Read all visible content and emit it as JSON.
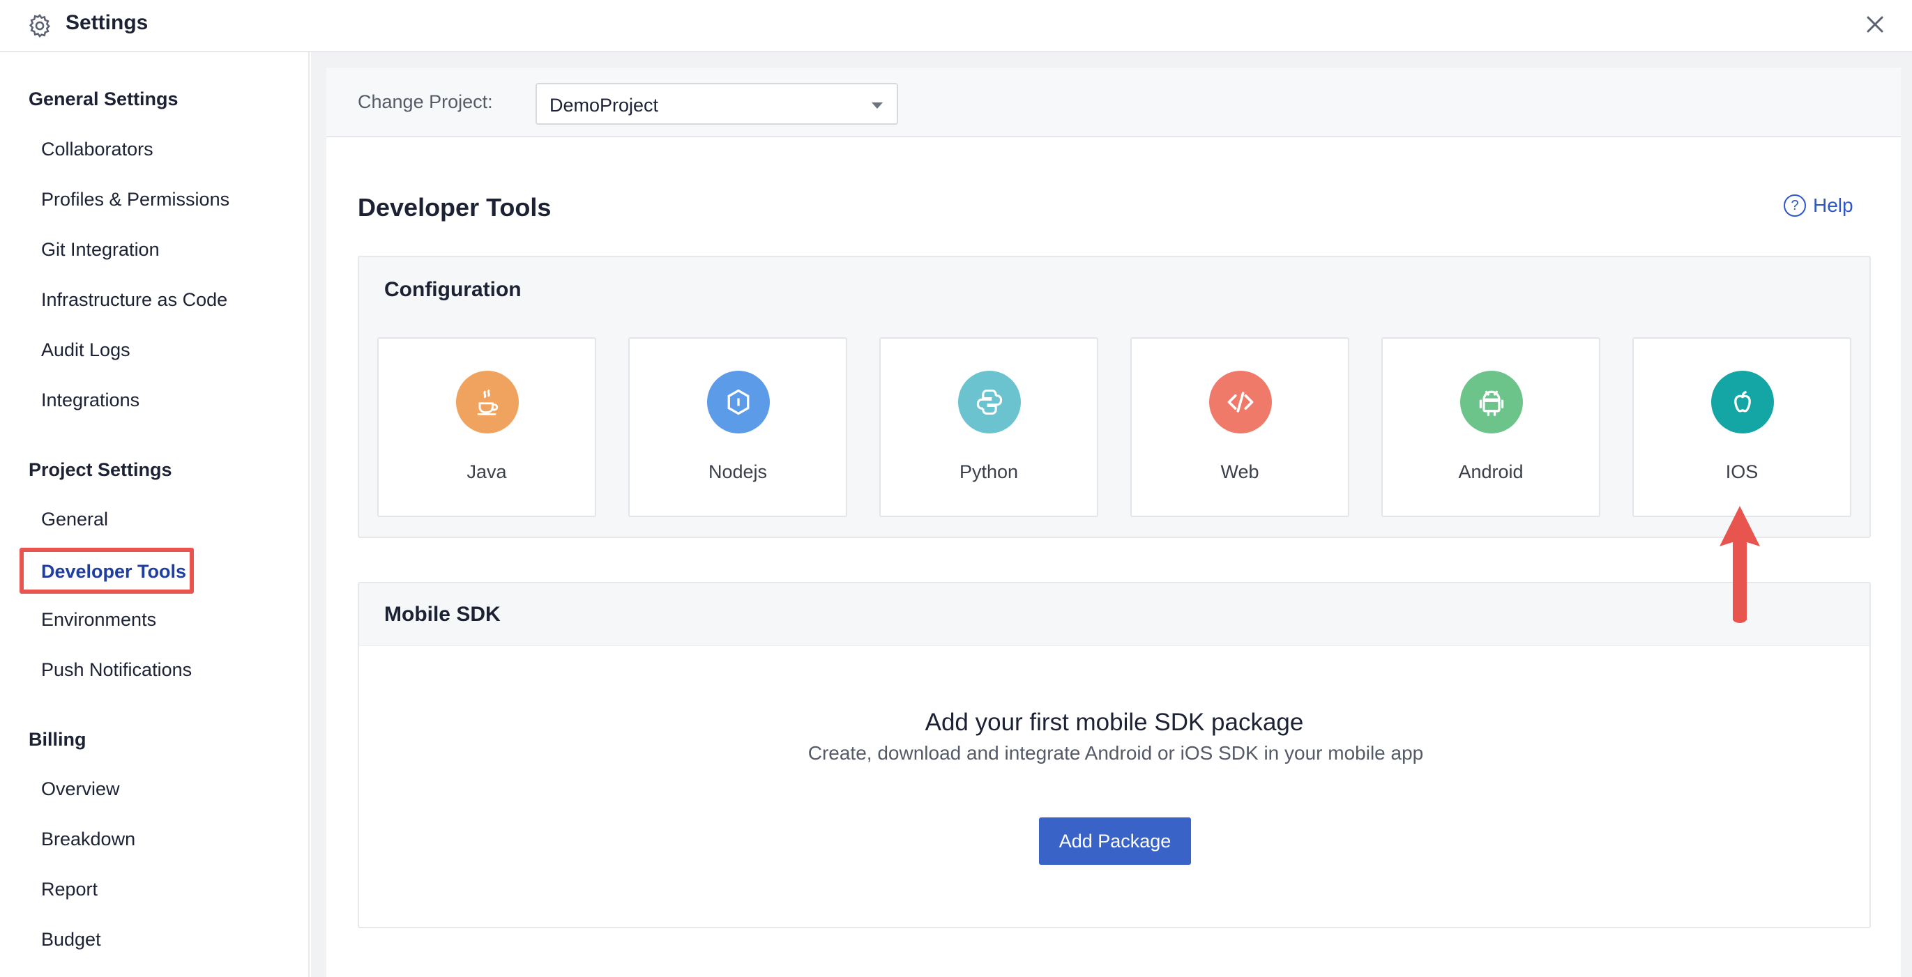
{
  "header": {
    "title": "Settings"
  },
  "sidebar": {
    "groups": [
      {
        "title": "General Settings",
        "items": [
          "Collaborators",
          "Profiles & Permissions",
          "Git Integration",
          "Infrastructure as Code",
          "Audit Logs",
          "Integrations"
        ]
      },
      {
        "title": "Project Settings",
        "items": [
          "General",
          "Developer Tools",
          "Environments",
          "Push Notifications"
        ]
      },
      {
        "title": "Billing",
        "items": [
          "Overview",
          "Breakdown",
          "Report",
          "Budget"
        ]
      }
    ],
    "active_item": "Developer Tools"
  },
  "project_bar": {
    "label": "Change Project:",
    "selected": "DemoProject"
  },
  "page": {
    "title": "Developer Tools",
    "help": "Help"
  },
  "configuration": {
    "title": "Configuration",
    "tiles": [
      {
        "name": "Java",
        "icon": "java-cup-icon",
        "color": "#f0a35e"
      },
      {
        "name": "Nodejs",
        "icon": "nodejs-hexagon-icon",
        "color": "#5b9be8"
      },
      {
        "name": "Python",
        "icon": "python-icon",
        "color": "#6cc3d0"
      },
      {
        "name": "Web",
        "icon": "code-brackets-icon",
        "color": "#ef7a6a"
      },
      {
        "name": "Android",
        "icon": "android-icon",
        "color": "#6cc48a"
      },
      {
        "name": "IOS",
        "icon": "apple-icon",
        "color": "#14a5a5"
      }
    ]
  },
  "mobile_sdk": {
    "title": "Mobile SDK",
    "empty_title": "Add your first mobile SDK package",
    "empty_desc": "Create, download and integrate Android or iOS SDK in your mobile app",
    "button": "Add Package"
  },
  "colors": {
    "accent": "#3a63c7",
    "highlight": "#e8544e",
    "active_text": "#1e3fa0"
  }
}
